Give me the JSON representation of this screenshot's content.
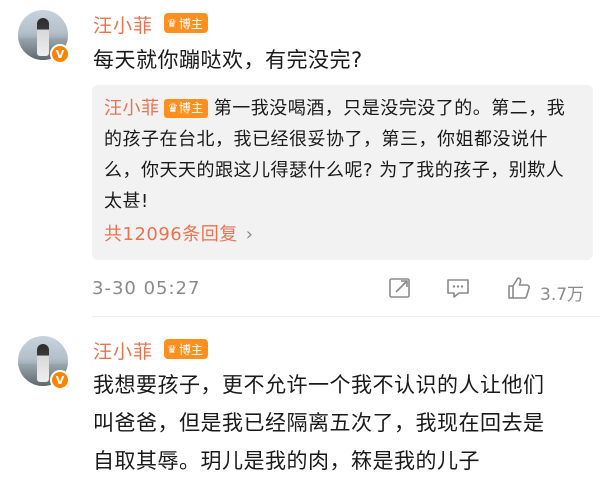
{
  "comments": [
    {
      "username": "汪小菲",
      "badge": "博主",
      "text": "每天就你蹦哒欢，有完没完?",
      "reply": {
        "username": "汪小菲",
        "badge": "博主",
        "text": "第一我没喝酒，只是没完没了的。第二，我的孩子在台北，我已经很妥协了，第三，你姐都没说什么，你天天的跟这儿得瑟什么呢? 为了我的孩子，别欺人太甚!",
        "reply_count": "共12096条回复",
        "chevron": "›"
      },
      "timestamp": "3-30 05:27",
      "likes": "3.7万"
    },
    {
      "username": "汪小菲",
      "badge": "博主",
      "text_lines": [
        "我想要孩子，更不允许一个我不认识的人让他们",
        "叫爸爸，但是我已经隔离五次了，我现在回去是",
        "自取其辱。玥儿是我的肉，箖是我的儿子"
      ]
    }
  ],
  "icons": {
    "verified": "verified-v-icon",
    "badge_crown": "crown-icon",
    "repost": "repost-icon",
    "comment": "comment-icon",
    "like": "like-thumb-icon"
  },
  "colors": {
    "username": "#eb7350",
    "badge": "#ff8f1f",
    "verified": "#ff8200",
    "meta": "#8a8a8a",
    "reply_bg": "#f2f2f2"
  }
}
